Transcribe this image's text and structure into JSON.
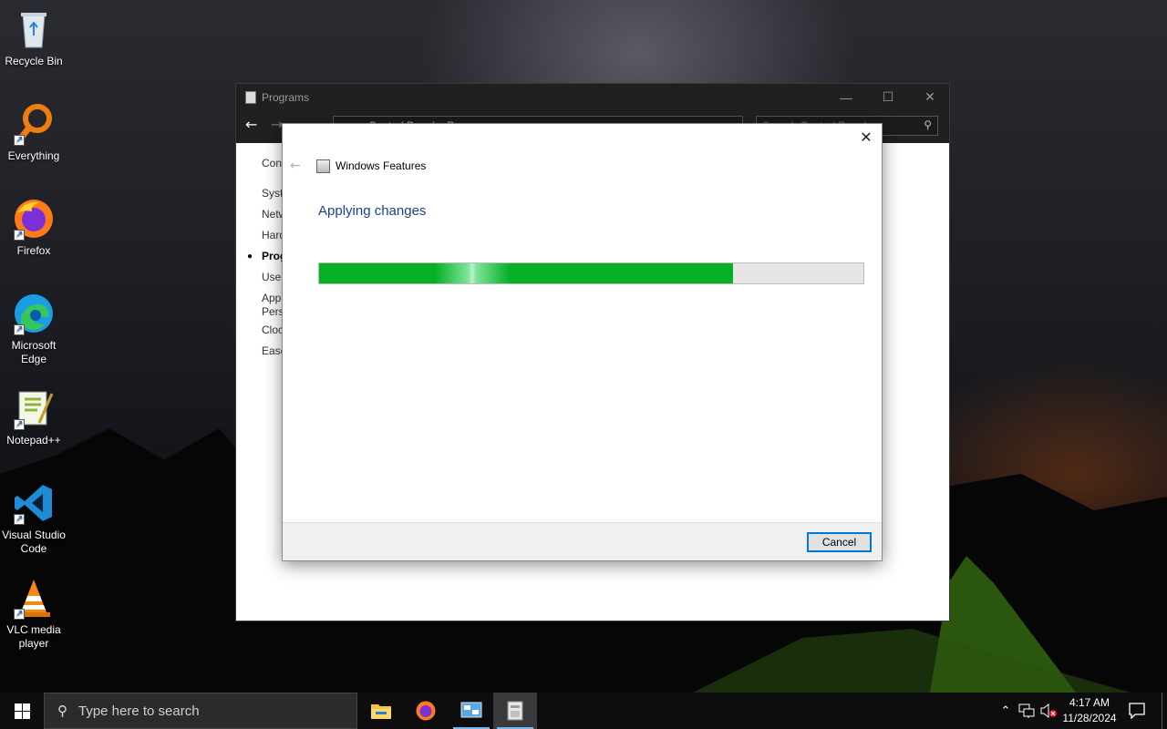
{
  "desktop": {
    "icons": [
      {
        "label": "Recycle Bin",
        "icon": "recycle-bin-icon"
      },
      {
        "label": "Everything",
        "icon": "everything-search-icon"
      },
      {
        "label": "Firefox",
        "icon": "firefox-icon"
      },
      {
        "label": "Microsoft Edge",
        "icon": "edge-icon"
      },
      {
        "label": "Notepad++",
        "icon": "notepadpp-icon"
      },
      {
        "label": "Visual Studio Code",
        "icon": "vscode-icon"
      },
      {
        "label": "VLC media player",
        "icon": "vlc-icon"
      }
    ]
  },
  "programs_window": {
    "title": "Programs",
    "address": "Control Panel > P",
    "search_placeholder": "Search Control Panel",
    "side_items": [
      "Con",
      "Syste",
      "Netw",
      "Hard",
      "Prog",
      "User",
      "App",
      "Pers",
      "Cloc",
      "Ease"
    ]
  },
  "dialog": {
    "title": "Windows Features",
    "heading": "Applying changes",
    "progress": 0.76,
    "cancel_label": "Cancel"
  },
  "taskbar": {
    "search_placeholder": "Type here to search",
    "time": "4:17 AM",
    "date": "11/28/2024"
  },
  "colors": {
    "progress_fill": "#06b025",
    "heading": "#1e3f8a",
    "button_focus": "#0078d7"
  }
}
